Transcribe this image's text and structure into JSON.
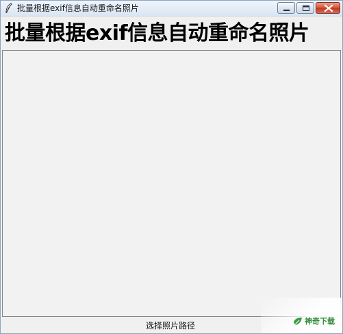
{
  "window": {
    "title": "批量根据exif信息自动重命名照片"
  },
  "main": {
    "heading": "批量根据exif信息自动重命名照片",
    "select_path_label": "选择照片路径"
  },
  "watermark": {
    "text": "神奇下载"
  },
  "icons": {
    "app": "feather-icon",
    "minimize": "minimize-icon",
    "maximize": "maximize-icon",
    "close": "close-icon",
    "watermark_logo": "leaf-logo-icon"
  },
  "colors": {
    "titlebar": "#dbe6f3",
    "close_button": "#c9452b",
    "frame_bg": "#f2f2f2",
    "watermark_green": "#2f8a3a"
  }
}
